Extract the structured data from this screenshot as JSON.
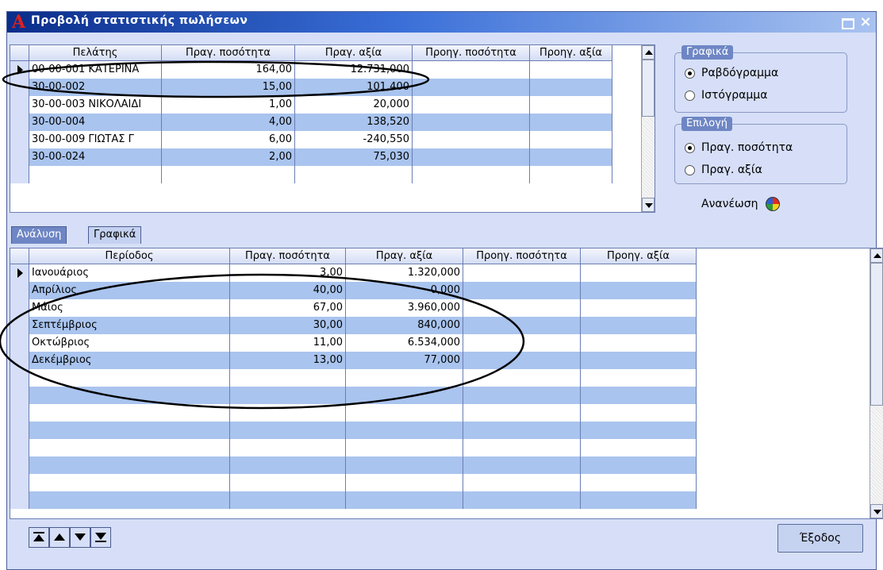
{
  "window": {
    "title": "Προβολή στατιστικής πωλήσεων"
  },
  "top_grid": {
    "columns": [
      "Πελάτης",
      "Πραγ. ποσότητα",
      "Πραγ. αξία",
      "Προηγ. ποσότητα",
      "Προηγ. αξία"
    ],
    "rows": [
      [
        "00-00-001 ΚΑΤΕΡΙΝΑ",
        "164,00",
        "12.731,000",
        "",
        ""
      ],
      [
        "30-00-002",
        "15,00",
        "101,400",
        "",
        ""
      ],
      [
        "30-00-003 ΝΙΚΟΛΑΙΔΙ",
        "1,00",
        "20,000",
        "",
        ""
      ],
      [
        "30-00-004",
        "4,00",
        "138,520",
        "",
        ""
      ],
      [
        "30-00-009 ΓΙΩΤΑΣ Γ",
        "6,00",
        "-240,550",
        "",
        ""
      ],
      [
        "30-00-024",
        "2,00",
        "75,030",
        "",
        ""
      ],
      [
        "",
        "",
        "",
        "",
        ""
      ]
    ]
  },
  "charts_group": {
    "legend": "Γραφικά",
    "options": [
      "Ραβδόγραμμα",
      "Ιστόγραμμα"
    ],
    "selected": "Ραβδόγραμμα"
  },
  "choice_group": {
    "legend": "Επιλογή",
    "options": [
      "Πραγ. ποσότητα",
      "Πραγ. αξία"
    ],
    "selected": "Πραγ. ποσότητα"
  },
  "refresh_label": "Ανανέωση",
  "tabs": [
    "Ανάλυση",
    "Γραφικά"
  ],
  "active_tab": "Ανάλυση",
  "bottom_grid": {
    "columns": [
      "Περίοδος",
      "Πραγ. ποσότητα",
      "Πραγ. αξία",
      "Προηγ. ποσότητα",
      "Προηγ. αξία"
    ],
    "rows": [
      [
        "Ιανουάριος",
        "3,00",
        "1.320,000",
        "",
        ""
      ],
      [
        "Απρίλιος",
        "40,00",
        "0,000",
        "",
        ""
      ],
      [
        "Μάιος",
        "67,00",
        "3.960,000",
        "",
        ""
      ],
      [
        "Σεπτέμβριος",
        "30,00",
        "840,000",
        "",
        ""
      ],
      [
        "Οκτώβριος",
        "11,00",
        "6.534,000",
        "",
        ""
      ],
      [
        "Δεκέμβριος",
        "13,00",
        "77,000",
        "",
        ""
      ],
      [
        "",
        "",
        "",
        "",
        ""
      ],
      [
        "",
        "",
        "",
        "",
        ""
      ],
      [
        "",
        "",
        "",
        "",
        ""
      ],
      [
        "",
        "",
        "",
        "",
        ""
      ],
      [
        "",
        "",
        "",
        "",
        ""
      ],
      [
        "",
        "",
        "",
        "",
        ""
      ],
      [
        "",
        "",
        "",
        "",
        ""
      ],
      [
        "",
        "",
        "",
        "",
        ""
      ]
    ]
  },
  "exit_label": "Έξοδος",
  "colors": {
    "row_alt": "#a9c4ee",
    "panel": "#d6dff7",
    "title_bar": "#0a2d8a"
  }
}
